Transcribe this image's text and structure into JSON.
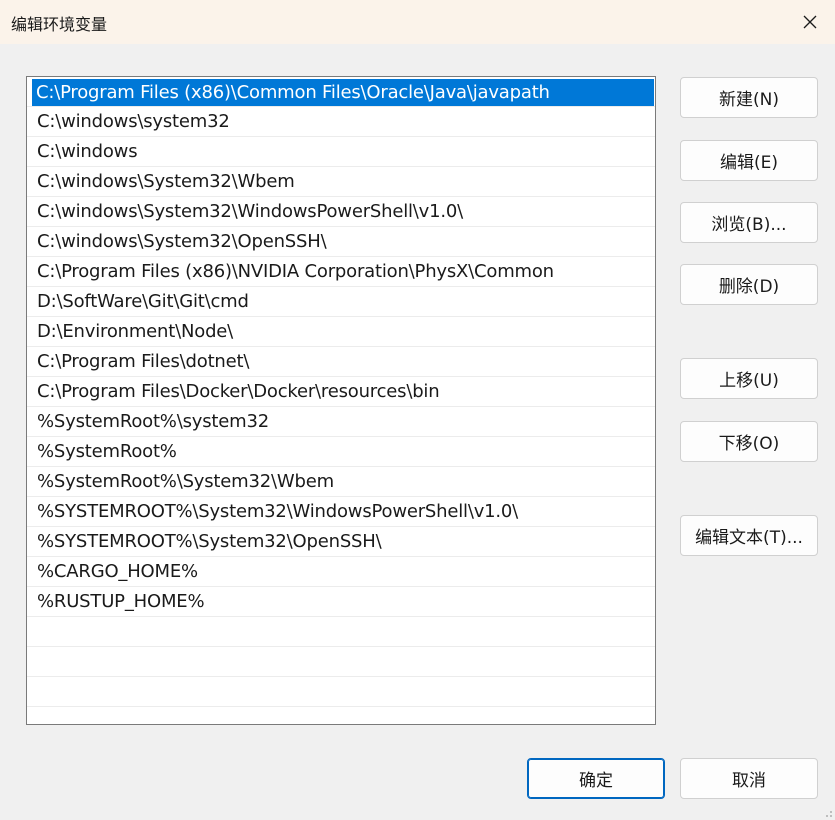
{
  "window": {
    "title": "编辑环境变量",
    "titlebar_color": "#fbf3ea",
    "accent": "#0078d7"
  },
  "list": {
    "selected_index": 0,
    "items": [
      "C:\\Program Files (x86)\\Common Files\\Oracle\\Java\\javapath",
      "C:\\windows\\system32",
      "C:\\windows",
      "C:\\windows\\System32\\Wbem",
      "C:\\windows\\System32\\WindowsPowerShell\\v1.0\\",
      "C:\\windows\\System32\\OpenSSH\\",
      "C:\\Program Files (x86)\\NVIDIA Corporation\\PhysX\\Common",
      "D:\\SoftWare\\Git\\Git\\cmd",
      "D:\\Environment\\Node\\",
      "C:\\Program Files\\dotnet\\",
      "C:\\Program Files\\Docker\\Docker\\resources\\bin",
      "%SystemRoot%\\system32",
      "%SystemRoot%",
      "%SystemRoot%\\System32\\Wbem",
      "%SYSTEMROOT%\\System32\\WindowsPowerShell\\v1.0\\",
      "%SYSTEMROOT%\\System32\\OpenSSH\\",
      "%CARGO_HOME%",
      "%RUSTUP_HOME%"
    ],
    "empty_rows": 4
  },
  "buttons": {
    "new": "新建(N)",
    "edit": "编辑(E)",
    "browse": "浏览(B)...",
    "delete": "删除(D)",
    "move_up": "上移(U)",
    "move_down": "下移(O)",
    "edit_text": "编辑文本(T)...",
    "ok": "确定",
    "cancel": "取消"
  },
  "icons": {
    "close": "close-icon",
    "resize": "resize-grip-icon"
  }
}
